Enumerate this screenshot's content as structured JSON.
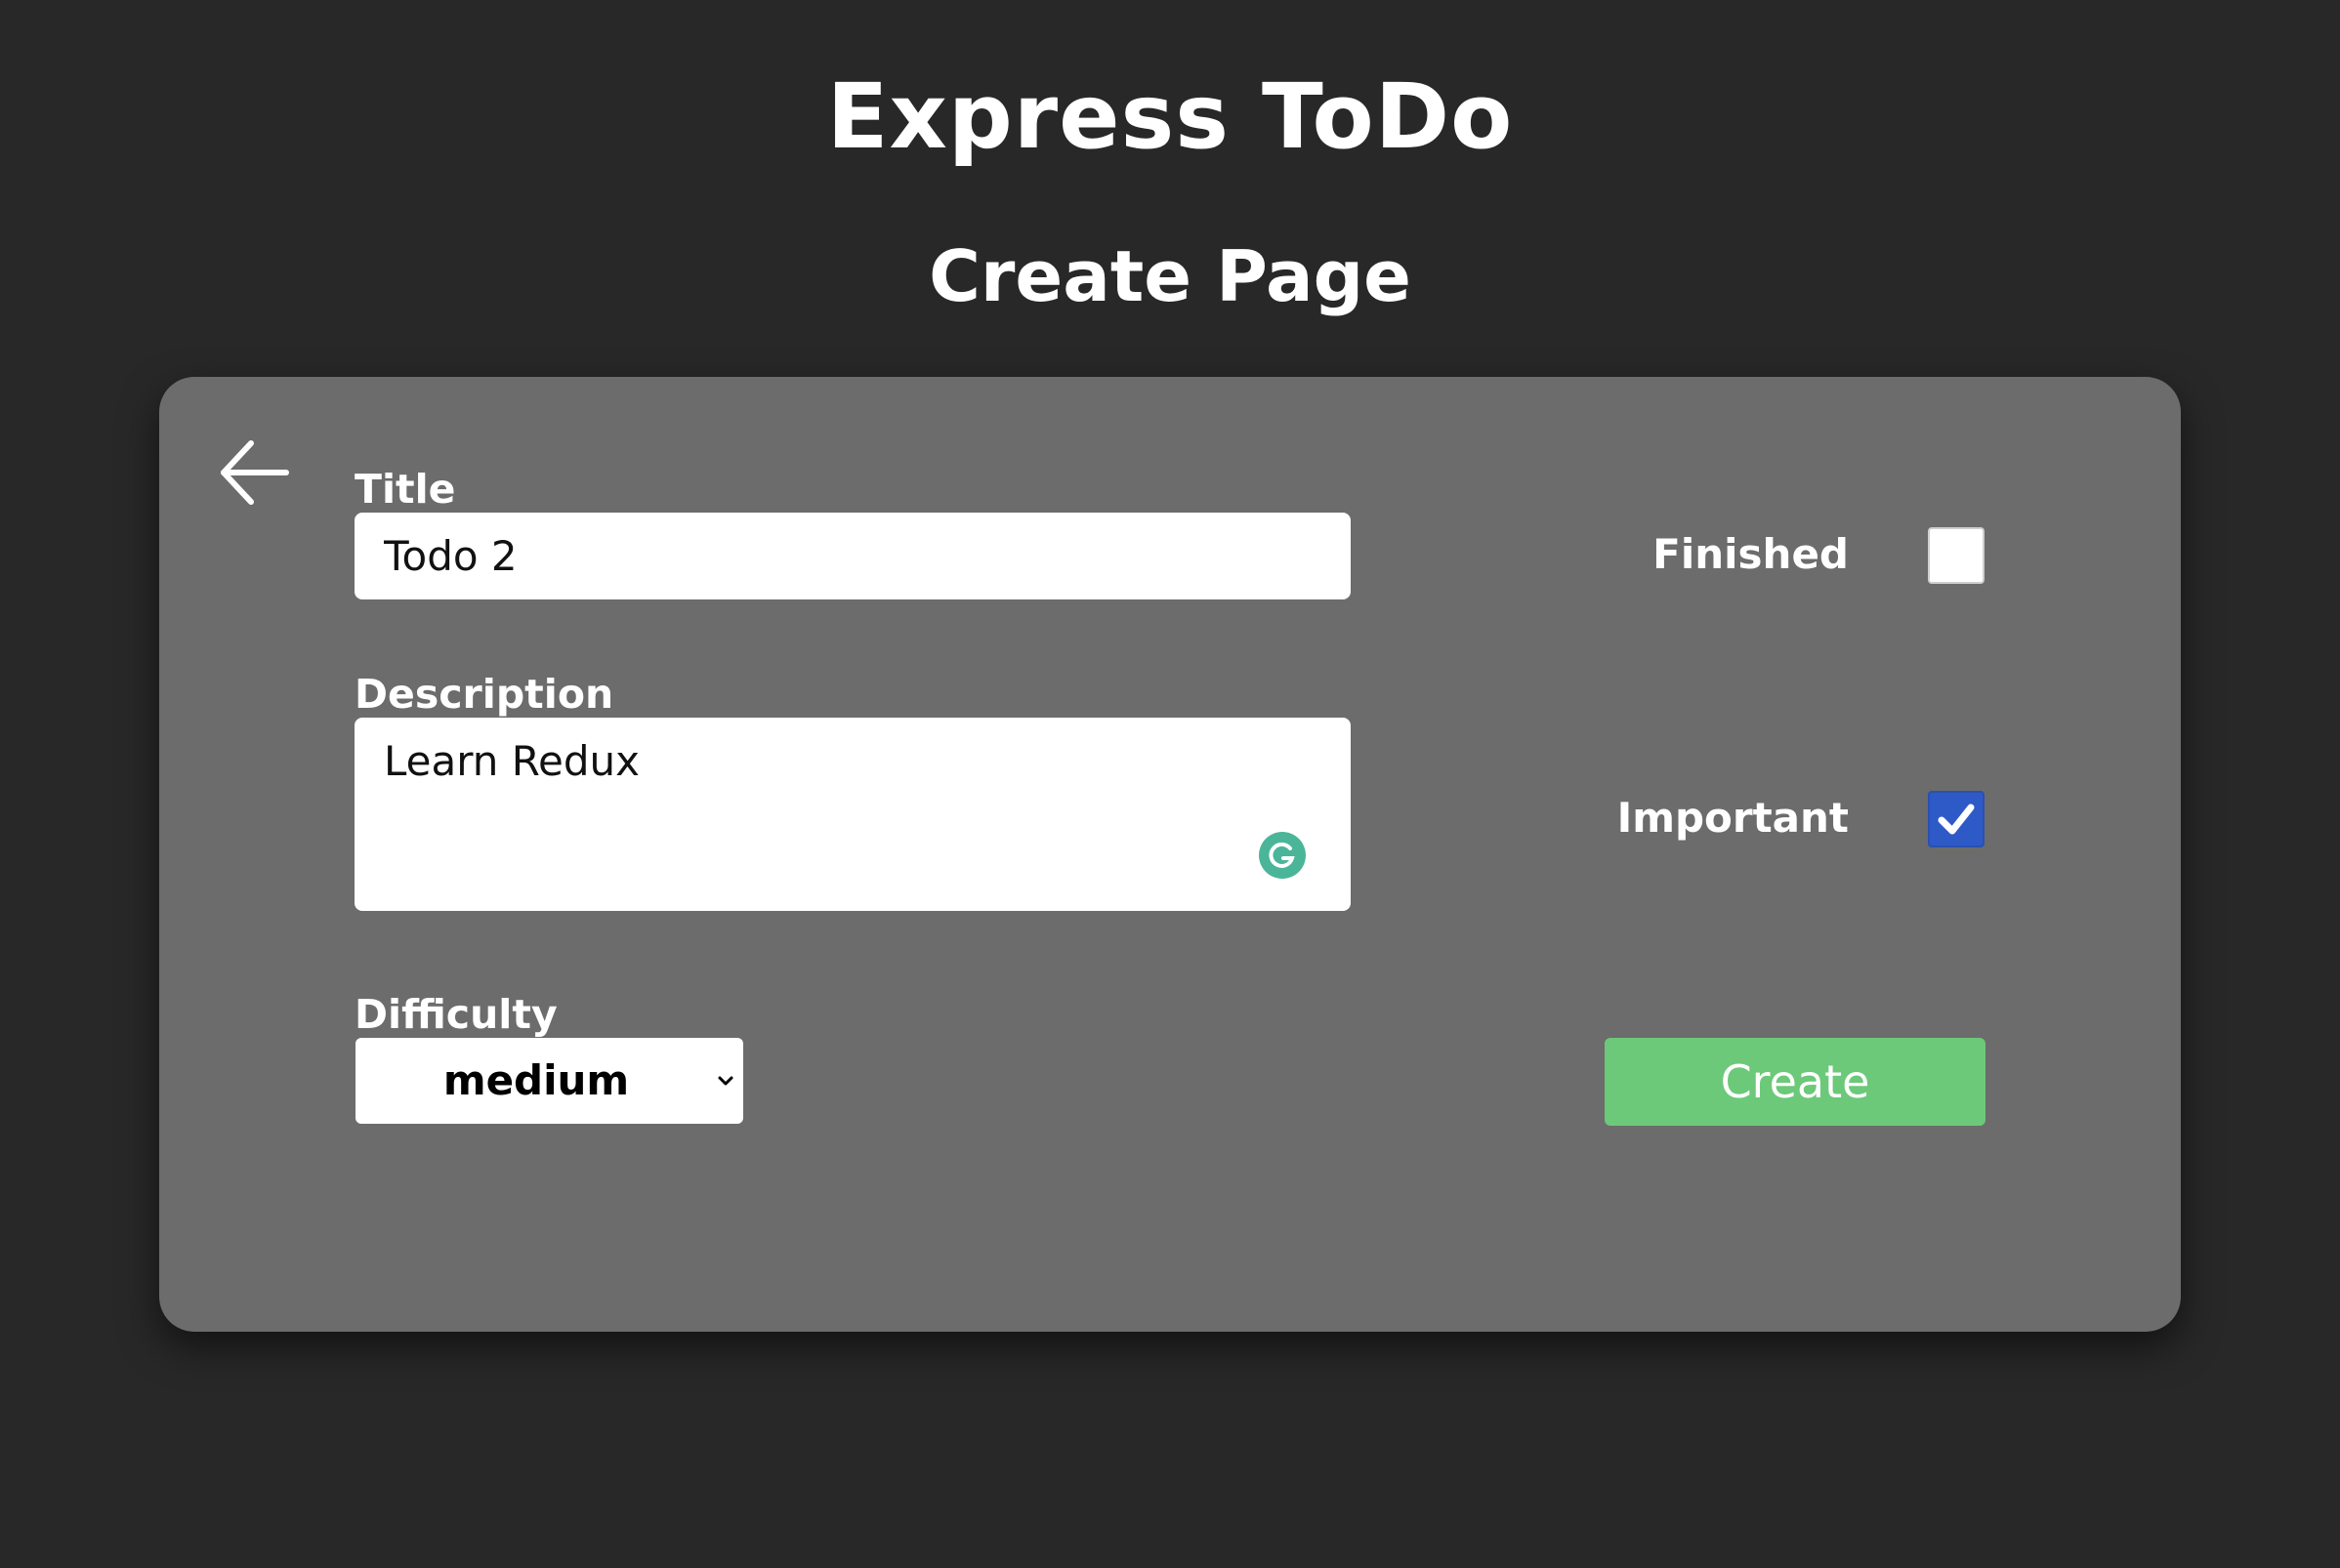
{
  "header": {
    "app_title": "Express ToDo",
    "page_title": "Create Page"
  },
  "form": {
    "back_icon": "arrow-left-icon",
    "title": {
      "label": "Title",
      "value": "Todo 2"
    },
    "description": {
      "label": "Description",
      "value": "Learn Redux",
      "grammarly_icon": "grammarly-icon"
    },
    "difficulty": {
      "label": "Difficulty",
      "selected": "medium"
    },
    "finished": {
      "label": "Finished",
      "checked": false
    },
    "important": {
      "label": "Important",
      "checked": true
    },
    "submit_label": "Create"
  },
  "colors": {
    "background": "#282828",
    "card": "#6c6c6c",
    "create_button": "#6cc979",
    "checkbox_checked": "#2e5ac8",
    "grammarly": "#4bb59a"
  }
}
